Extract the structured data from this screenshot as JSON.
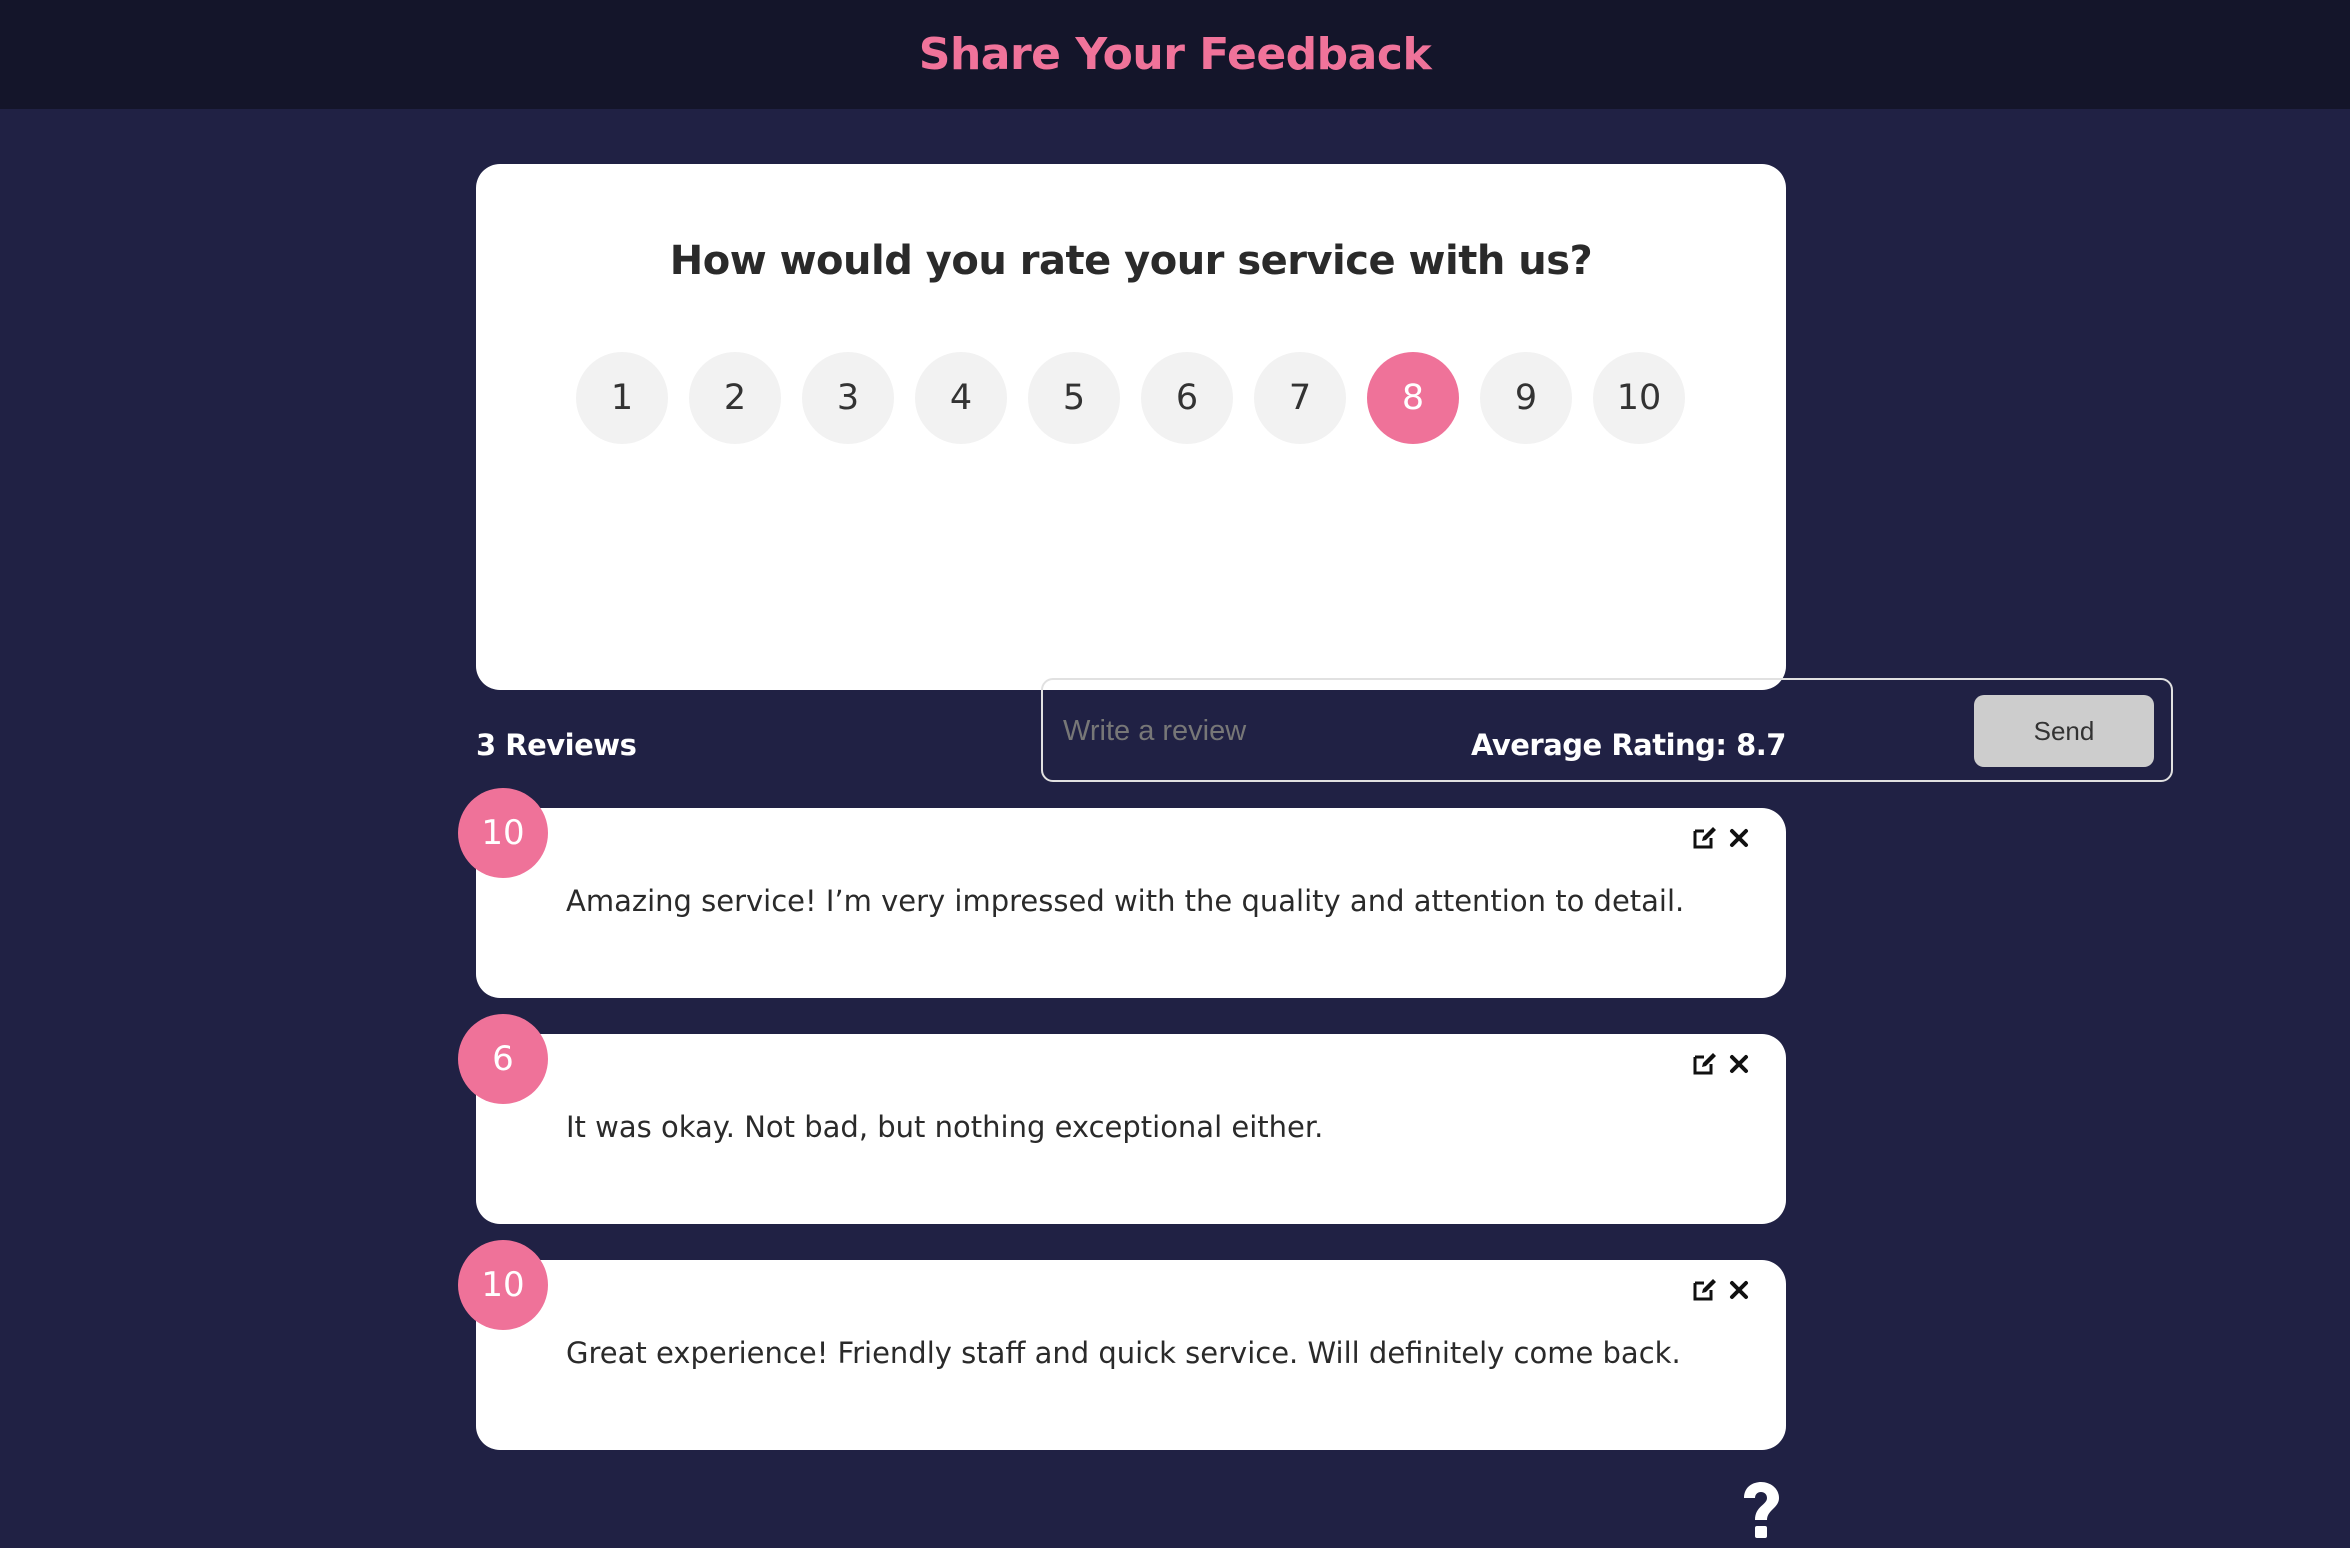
{
  "header": {
    "title": "Share Your Feedback"
  },
  "form": {
    "question": "How would you rate your service with us?",
    "ratings": [
      "1",
      "2",
      "3",
      "4",
      "5",
      "6",
      "7",
      "8",
      "9",
      "10"
    ],
    "selected_rating": "8",
    "review_placeholder": "Write a review",
    "review_value": "",
    "send_label": "Send"
  },
  "summary": {
    "review_count": "3 Reviews",
    "average_rating": "Average Rating: 8.7"
  },
  "reviews": [
    {
      "rating": "10",
      "text": "Amazing service! I’m very impressed with the quality and attention to detail."
    },
    {
      "rating": "6",
      "text": "It was okay. Not bad, but nothing exceptional either."
    },
    {
      "rating": "10",
      "text": "Great experience! Friendly staff and quick service. Will definitely come back."
    }
  ],
  "icons": {
    "edit": "edit-icon",
    "delete": "close-icon",
    "help": "question-mark-icon"
  },
  "colors": {
    "accent": "#ef7299",
    "background": "#202144",
    "header_bg": "#14152a",
    "card_bg": "#ffffff"
  }
}
